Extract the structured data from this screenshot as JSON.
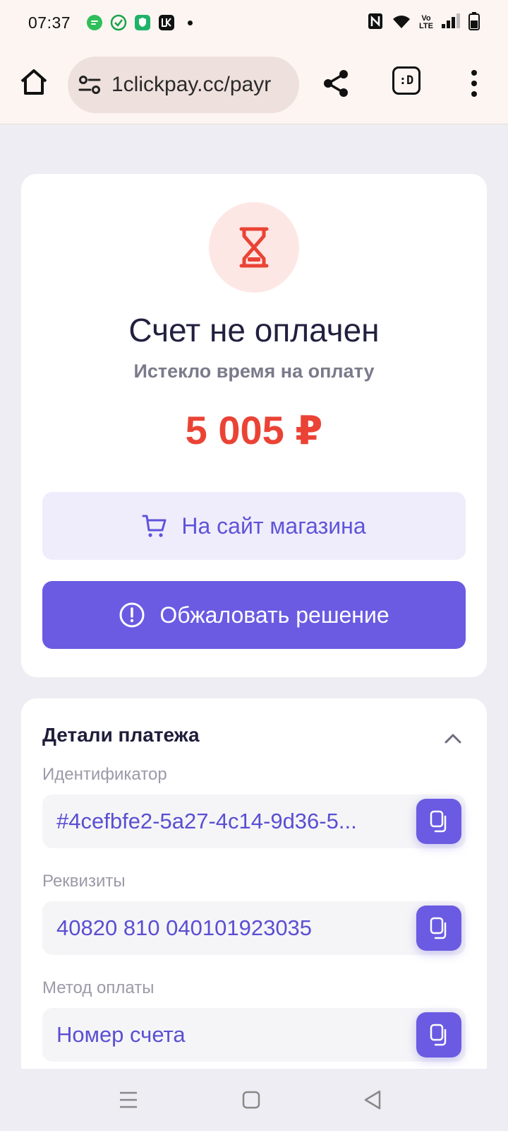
{
  "status_bar": {
    "time": "07:37",
    "icons": [
      "chat-app-icon",
      "check-app-icon",
      "shield-app-icon",
      "bank-app-icon",
      "dot-icon",
      "nfc-icon",
      "wifi-icon",
      "volte-icon",
      "signal-icon",
      "battery-icon"
    ],
    "volte_top": "Vo",
    "volte_bottom": "LTE"
  },
  "browser": {
    "url": "1clickpay.cc/payr",
    "ext_label": ":D"
  },
  "payment_status": {
    "title": "Счет не оплачен",
    "subtitle": "Истекло время на оплату",
    "amount": "5 005 ₽",
    "accent": "#ea4335",
    "shop_button": "На сайт магазина",
    "appeal_button": "Обжаловать решение"
  },
  "details": {
    "header": "Детали платежа",
    "fields": [
      {
        "label": "Идентификатор",
        "value": "#4cefbfe2-5a27-4c14-9d36-5..."
      },
      {
        "label": "Реквизиты",
        "value": "40820 810 040101923035"
      },
      {
        "label": "Метод оплаты",
        "value": "Номер счета"
      }
    ]
  },
  "colors": {
    "primary": "#6a5be2",
    "danger": "#ea4335",
    "background": "#eeedf3"
  }
}
